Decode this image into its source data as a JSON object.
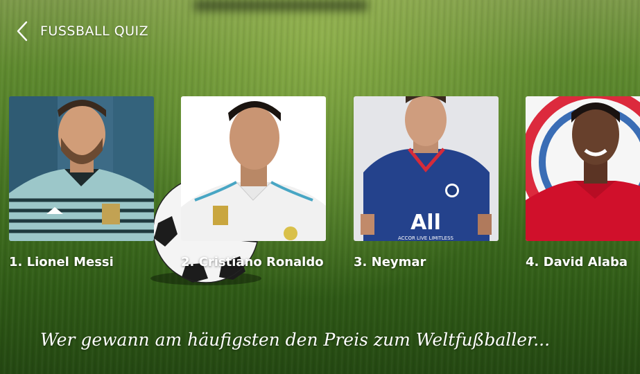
{
  "header": {
    "back_icon": "chevron-left-icon",
    "title": "FUSSBALL QUIZ"
  },
  "players": [
    {
      "label": "1. Lionel Messi",
      "photo": "player-photo-messi",
      "shirt": "#9cc7c9",
      "bg": "#3f6f8c"
    },
    {
      "label": "2. Cristiano Ronaldo",
      "photo": "player-photo-ronaldo",
      "shirt": "#f3f3f3",
      "bg": "#ffffff"
    },
    {
      "label": "3. Neymar",
      "photo": "player-photo-neymar",
      "shirt": "#23408e",
      "bg": "#e6e6e8"
    },
    {
      "label": "4. David Alaba",
      "photo": "player-photo-alaba",
      "shirt": "#d0102b",
      "bg": "#f7f7f7"
    }
  ],
  "question": "Wer gewann am häufigsten den Preis zum Weltfußballer..."
}
